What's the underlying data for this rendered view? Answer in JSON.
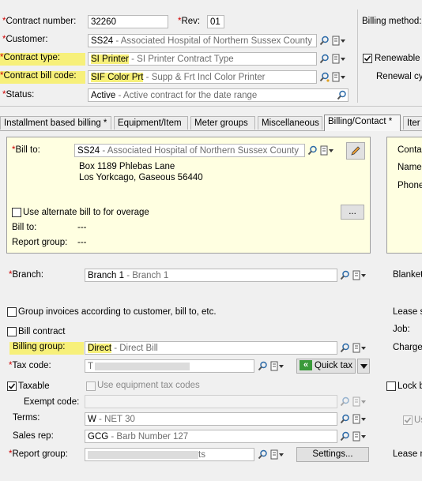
{
  "header": {
    "contract_number": {
      "label": "Contract number:",
      "value": "32260"
    },
    "rev": {
      "label": "Rev:",
      "value": "01"
    },
    "customer": {
      "label": "Customer:",
      "code": "SS24",
      "desc": " - Associated Hospital of Northern Sussex County"
    },
    "contract_type": {
      "label": "Contract type:",
      "code": "SI Printer",
      "desc": " - SI Printer Contract Type"
    },
    "contract_bill_code": {
      "label": "Contract bill code:",
      "code": "SIF Color Prt",
      "desc": " - Supp & Frt Incl Color Printer"
    },
    "status": {
      "label": "Status:",
      "code": "Active",
      "desc": " - Active contract for the date range"
    },
    "billing_method_label": "Billing method:",
    "renewable_label": "Renewable",
    "renewable_checked": true,
    "renewal_label": "Renewal cyc"
  },
  "tabs": [
    {
      "label": "Installment based billing *",
      "active": false
    },
    {
      "label": "Equipment/Item",
      "active": false
    },
    {
      "label": "Meter groups",
      "active": false
    },
    {
      "label": "Miscellaneous",
      "active": false
    },
    {
      "label": "Billing/Contact *",
      "active": true
    },
    {
      "label": "Iter",
      "active": false
    }
  ],
  "bill_to": {
    "label": "Bill to:",
    "code": "SS24",
    "desc": " - Associated Hospital of Northern Sussex County",
    "address_line1": "Box 1189 Phlebas Lane",
    "address_line2": "Los Yorkcago, Gaseous 56440",
    "alternate_label": "Use alternate bill to for overage",
    "alt_more_button": "...",
    "alt_bill_to_label": "Bill to:",
    "alt_bill_to_value": "---",
    "alt_report_group_label": "Report group:",
    "alt_report_group_value": "---"
  },
  "contact_panel": {
    "contact_label": "Contac",
    "name_label": "Name:",
    "phone_label": "Phone"
  },
  "branch": {
    "label": "Branch:",
    "code": "Branch 1",
    "desc": " - Branch 1"
  },
  "blanket_label": "Blanket",
  "group_invoices_label": "Group invoices according to customer, bill to, etc.",
  "bill_contract_label": "Bill contract",
  "billing_group": {
    "label": "Billing group:",
    "code": "Direct",
    "desc": " - Direct Bill"
  },
  "tax_code": {
    "label": "Tax code:",
    "partial": "T",
    "quick_tax_label": "Quick tax"
  },
  "taxable_label": "Taxable",
  "taxable_checked": true,
  "use_equipment_tax_label": "Use equipment tax codes",
  "exempt_code_label": "Exempt code:",
  "terms": {
    "label": "Terms:",
    "code": "W",
    "desc": " - NET 30"
  },
  "sales_rep": {
    "label": "Sales rep:",
    "code": "GCG",
    "desc": " - Barb Number 127"
  },
  "report_group": {
    "label": "Report group:",
    "tail": "ts",
    "settings_label": "Settings..."
  },
  "right_column": {
    "lease_s": "Lease s",
    "job": "Job:",
    "charge": "Charge",
    "lock_b": "Lock b",
    "us": "Us",
    "lease_m": "Lease m"
  },
  "colors": {
    "highlight": "#f7f07a",
    "required": "#d00000",
    "panel": "#ffffe1"
  }
}
